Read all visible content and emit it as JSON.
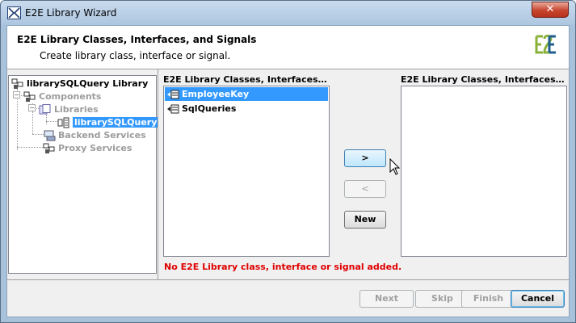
{
  "window": {
    "title": "E2E Library Wizard",
    "close_label": "✕",
    "icon": "wizard-app-icon"
  },
  "header": {
    "title": "E2E Library Classes, Interfaces, and Signals",
    "subtitle": "Create library class, interface or signal.",
    "logo_icon": "e2e-logo-icon"
  },
  "tree": {
    "items": [
      {
        "label": "librarySQLQuery Library",
        "state": "normal",
        "icon": "library-icon"
      },
      {
        "label": "Components",
        "state": "disabled",
        "icon": "components-icon"
      },
      {
        "label": "Libraries",
        "state": "disabled",
        "icon": "libraries-icon"
      },
      {
        "label": "librarySQLQuery",
        "state": "selected",
        "icon": "library-item-icon"
      },
      {
        "label": "Backend Services",
        "state": "disabled",
        "icon": "backend-services-icon"
      },
      {
        "label": "Proxy Services",
        "state": "disabled",
        "icon": "proxy-services-icon"
      }
    ]
  },
  "available_list": {
    "label": "E2E Library Classes, Interfaces, an...",
    "items": [
      {
        "label": "EmployeeKey",
        "selected": true,
        "icon": "class-icon"
      },
      {
        "label": "SqlQueries",
        "selected": false,
        "icon": "class-icon"
      }
    ]
  },
  "selected_list": {
    "label": "E2E Library Classes, Interfaces and...",
    "items": []
  },
  "actions": {
    "add_label": ">",
    "remove_label": "<",
    "new_label": "New"
  },
  "error_message": "No E2E Library class, interface or signal added.",
  "footer": {
    "next_label": "Next",
    "skip_label": "Skip",
    "finish_label": "Finish",
    "cancel_label": "Cancel"
  },
  "colors": {
    "selection": "#3399ff",
    "error": "#e00000",
    "close_button": "#c7452e",
    "titlebar": "#adc6e0"
  }
}
